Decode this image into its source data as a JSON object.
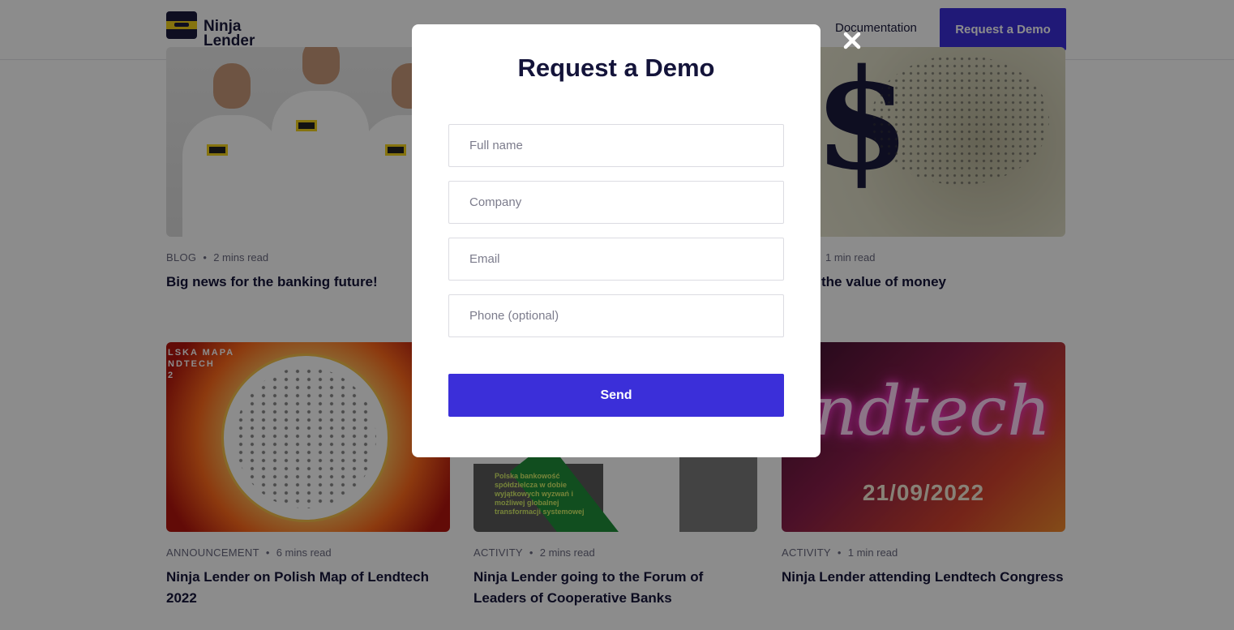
{
  "header": {
    "logo_line1": "Ninja",
    "logo_line2": "Lender",
    "nav_documentation": "Documentation",
    "nav_request_demo": "Request a Demo"
  },
  "cards": [
    {
      "category": "BLOG",
      "read": "2 mins read",
      "title": "Big news for the banking future!"
    },
    {
      "category": "",
      "read": "1 min read",
      "title": "the value of money"
    },
    {
      "category": "ANNOUNCEMENT",
      "read": "6 mins read",
      "title": "Ninja Lender on Polish Map of Lendtech 2022"
    },
    {
      "category": "ACTIVITY",
      "read": "2 mins read",
      "title": "Ninja Lender going to the Forum of Leaders of Cooperative Banks"
    },
    {
      "category": "ACTIVITY",
      "read": "1 min read",
      "title": "Ninja Lender attending Lendtech Congress"
    }
  ],
  "thumbs": {
    "map_label": "LSKA MAPA\nNDTECH\n2",
    "forum_text": "Polska bankowość spółdzielcza w dobie wyjątkowych wyzwań i możliwej globalnej transformacji systemowej",
    "congress_script": "endtech",
    "congress_date": "21/09/2022"
  },
  "modal": {
    "title": "Request a Demo",
    "full_name_placeholder": "Full name",
    "company_placeholder": "Company",
    "email_placeholder": "Email",
    "phone_placeholder": "Phone (optional)",
    "send_label": "Send"
  },
  "colors": {
    "brand_primary": "#3b2fd9",
    "brand_dark": "#14143a",
    "logo_yellow": "#f2d21c"
  }
}
